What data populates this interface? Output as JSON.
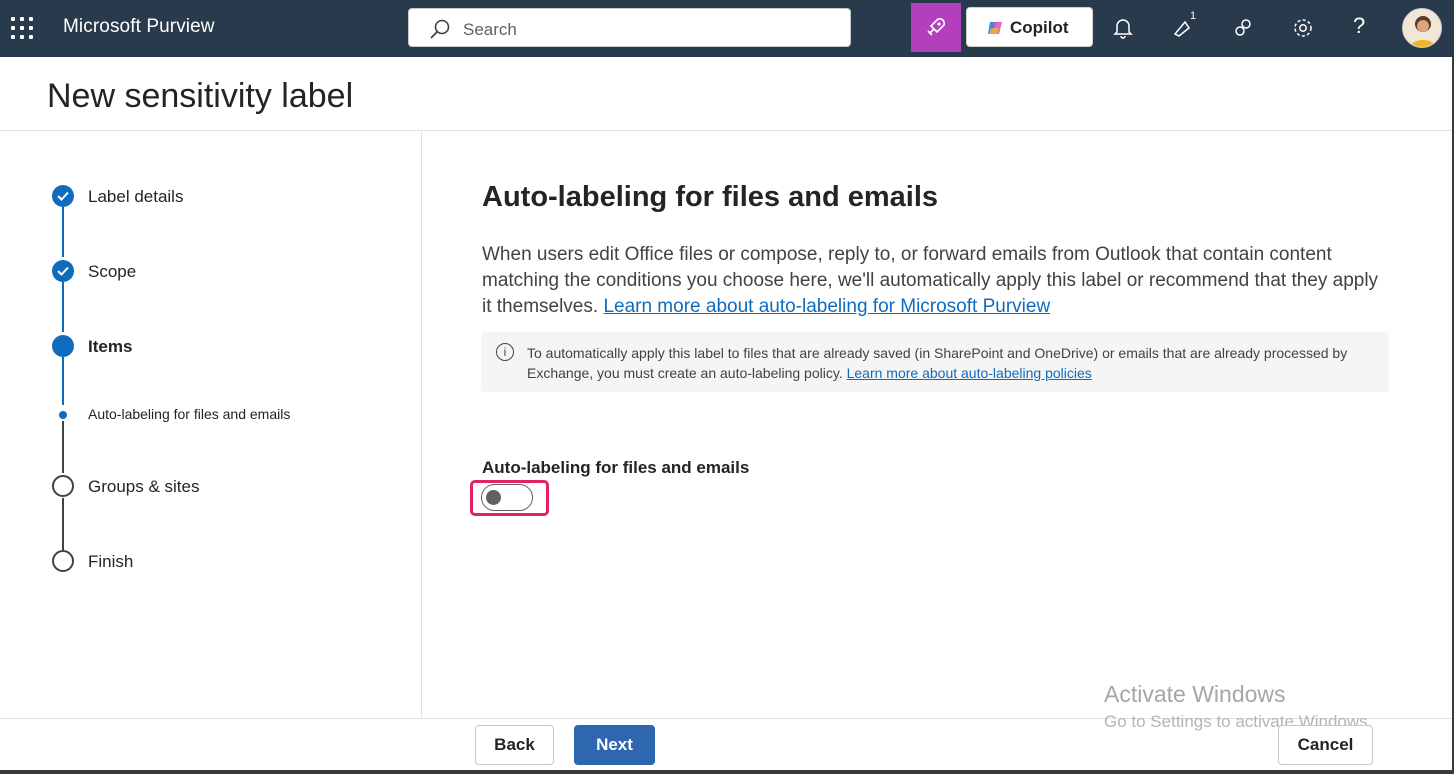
{
  "topbar": {
    "app_name": "Microsoft Purview",
    "search_placeholder": "Search",
    "copilot_label": "Copilot",
    "notification_badge": "1",
    "help_label": "?"
  },
  "header": {
    "title": "New sensitivity label"
  },
  "steps": [
    {
      "label": "Label details",
      "state": "completed"
    },
    {
      "label": "Scope",
      "state": "completed"
    },
    {
      "label": "Items",
      "state": "current"
    },
    {
      "label": "Auto-labeling for files and emails",
      "state": "current-substep"
    },
    {
      "label": "Groups & sites",
      "state": "pending"
    },
    {
      "label": "Finish",
      "state": "pending"
    }
  ],
  "main": {
    "title": "Auto-labeling for files and emails",
    "description": "When users edit Office files or compose, reply to, or forward emails from Outlook that contain content matching the conditions you choose here, we'll automatically apply this label or recommend that they apply it themselves.",
    "description_link": "Learn more about auto-labeling for Microsoft Purview",
    "info_text": "To automatically apply this label to files that are already saved (in SharePoint and OneDrive) or emails that are already processed by Exchange, you must create an auto-labeling policy.",
    "info_link": "Learn more about auto-labeling policies",
    "toggle_label": "Auto-labeling for files and emails",
    "toggle_on": false
  },
  "footer": {
    "back_label": "Back",
    "next_label": "Next",
    "cancel_label": "Cancel"
  },
  "watermark": {
    "line1": "Activate Windows",
    "line2": "Go to Settings to activate Windows."
  },
  "colors": {
    "topbar_bg": "#2a3a4d",
    "accent": "#0f6cbd",
    "copilot_feature": "#b43fbd",
    "highlight": "#e3245c",
    "next_button": "#2e66b0"
  }
}
